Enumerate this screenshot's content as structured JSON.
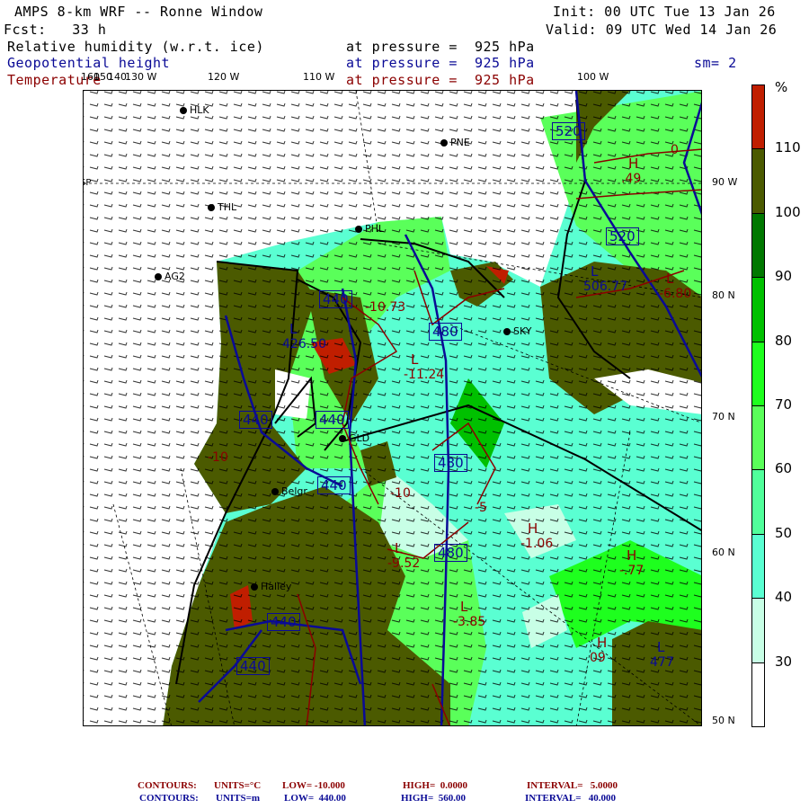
{
  "header": {
    "title": "AMPS 8-km WRF -- Ronne Window",
    "init": "Init: 00 UTC Tue 13 Jan 26",
    "fcst": "Fcst:   33 h",
    "valid": "Valid: 09 UTC Wed 14 Jan 26",
    "fields": [
      {
        "name": "Relative humidity (w.r.t. ice)",
        "level": "at pressure =  925 hPa"
      },
      {
        "name": "Geopotential height",
        "level": "at pressure =  925 hPa"
      },
      {
        "name": "Temperature",
        "level": "at pressure =  925 hPa"
      }
    ],
    "smoothing": "sm= 2"
  },
  "longitude_labels": [
    "160",
    "150",
    "140",
    "130 W",
    "120 W",
    "110 W",
    "100 W"
  ],
  "latitude_labels": [
    "90 W",
    "80 N",
    "70 N",
    "60 N",
    "50 N"
  ],
  "grid_label_sp": "SP",
  "stations": [
    "HLK",
    "PNE",
    "THL",
    "PHL",
    "AG2",
    "SKY",
    "GLD",
    "Belgr",
    "Halley"
  ],
  "height_contour_labels": [
    "520",
    "520",
    "480",
    "480",
    "480",
    "440",
    "440",
    "440",
    "440",
    "440",
    "440"
  ],
  "extrema": [
    {
      "type": "H",
      "value": "-1.06",
      "field": "temperature"
    },
    {
      "type": "H",
      "value": "-.77",
      "field": "temperature"
    },
    {
      "type": "L",
      "value": "-3.85",
      "field": "temperature"
    },
    {
      "type": "L",
      "value": "-9.52",
      "field": "temperature"
    },
    {
      "type": "L",
      "value": "-11.24",
      "field": "temperature"
    },
    {
      "type": "H",
      "value": ".49",
      "field": "temperature"
    },
    {
      "type": "L",
      "value": "-6.80",
      "field": "temperature"
    },
    {
      "type": "H",
      "value": "09",
      "field": "temperature"
    },
    {
      "type": "L",
      "value": "426.50",
      "field": "height"
    },
    {
      "type": "L",
      "value": "506.77",
      "field": "height"
    },
    {
      "type": "L",
      "value": "477",
      "field": "height"
    }
  ],
  "temp_contour_labels": [
    "-10",
    "-5",
    "-10",
    "0",
    "-10.73"
  ],
  "colorbar": {
    "unit": "%",
    "labels": [
      "110",
      "100",
      "90",
      "80",
      "70",
      "60",
      "50",
      "40",
      "30"
    ],
    "colors": [
      "#c01e00",
      "#4b5a00",
      "#007800",
      "#00c000",
      "#1eff1e",
      "#5aff5a",
      "#50ff9b",
      "#5affd2",
      "#c8ffe6",
      "#ffffff"
    ]
  },
  "footer": {
    "temp": {
      "label": "CONTOURS:",
      "units": "UNITS=°C",
      "low": "LOW= -10.000",
      "high": "HIGH=  0.0000",
      "interval": "INTERVAL=   5.0000"
    },
    "height": {
      "label": "CONTOURS:",
      "units": "UNITS=m",
      "low": "LOW=  440.00",
      "high": "HIGH=  560.00",
      "interval": "INTERVAL=   40.000"
    }
  }
}
